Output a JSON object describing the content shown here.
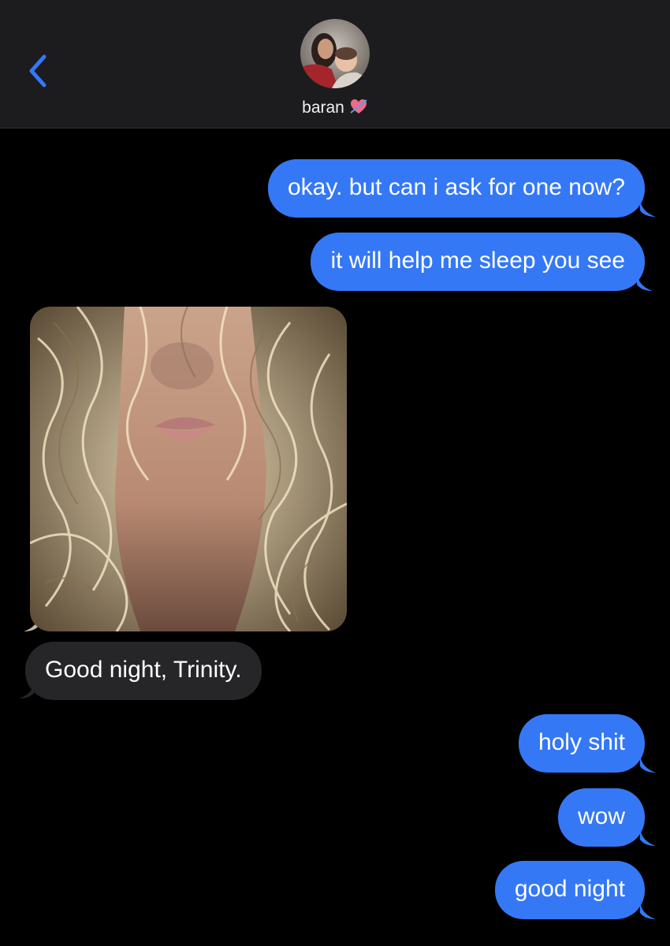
{
  "header": {
    "contact_name": "baran",
    "back_icon": "chevron-left-icon",
    "avatar": "contact-avatar",
    "name_emoji": "heart-with-arrow-icon"
  },
  "colors": {
    "sent_bubble": "#3478f6",
    "received_bubble": "#262628",
    "header_bg": "#1c1c1e",
    "accent": "#3478f6"
  },
  "messages": [
    {
      "direction": "sent",
      "text": "okay. but can i ask for one now?"
    },
    {
      "direction": "sent",
      "text": "it will help me sleep you see"
    },
    {
      "direction": "received",
      "type": "photo"
    },
    {
      "direction": "received",
      "text": "Good night, Trinity."
    },
    {
      "direction": "sent",
      "text": "holy shit"
    },
    {
      "direction": "sent",
      "text": "wow"
    },
    {
      "direction": "sent",
      "text": "good night"
    }
  ]
}
